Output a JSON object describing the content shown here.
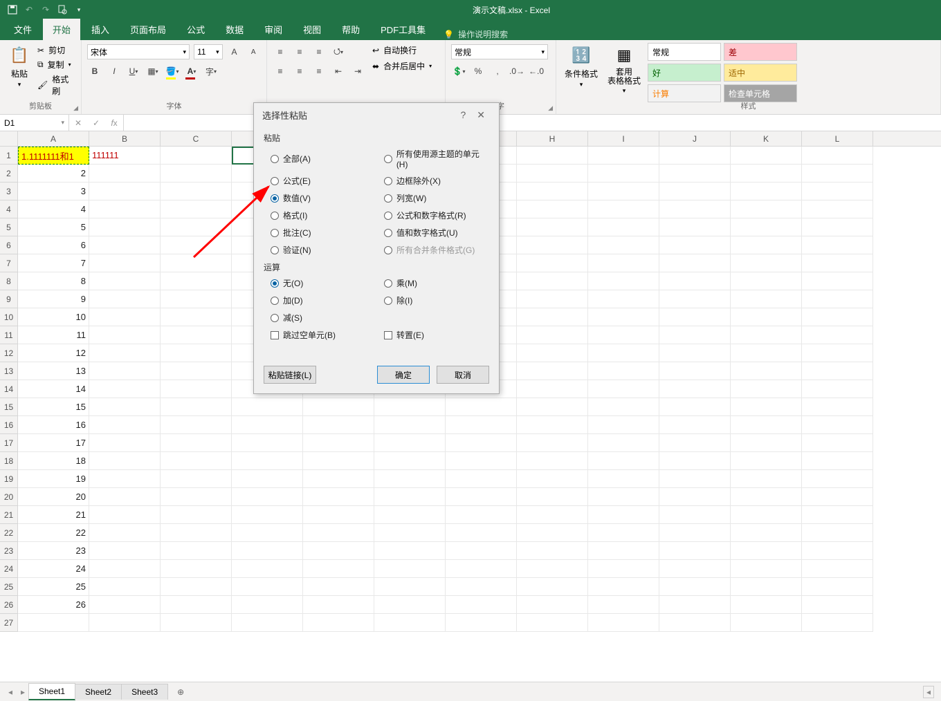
{
  "app": {
    "title": "演示文稿.xlsx  -  Excel"
  },
  "tabs": [
    "文件",
    "开始",
    "插入",
    "页面布局",
    "公式",
    "数据",
    "审阅",
    "视图",
    "帮助",
    "PDF工具集"
  ],
  "tellme": "操作说明搜索",
  "ribbon": {
    "clipboard": {
      "paste": "粘贴",
      "cut": "剪切",
      "copy": "复制",
      "painter": "格式刷",
      "label": "剪贴板"
    },
    "font": {
      "name": "宋体",
      "size": "11",
      "label": "字体"
    },
    "alignment": {
      "wrap": "自动换行",
      "merge": "合并后居中",
      "label": "字"
    },
    "number": {
      "format": "常规",
      "label": ""
    },
    "styles": {
      "cond": "条件格式",
      "tablefmt": "套用\n表格格式",
      "label": "样式",
      "cells": {
        "normal": "常规",
        "bad": "差",
        "good": "好",
        "neutral": "适中",
        "calc": "计算",
        "check": "检查单元格"
      }
    }
  },
  "namebox": "D1",
  "columns": [
    "A",
    "B",
    "C",
    "",
    "",
    "",
    "",
    "H",
    "I",
    "J",
    "K",
    "L"
  ],
  "rowData": {
    "1": {
      "A": "1.1111111和1",
      "B": "111111"
    },
    "2": {
      "A": "2"
    },
    "3": {
      "A": "3"
    },
    "4": {
      "A": "4"
    },
    "5": {
      "A": "5"
    },
    "6": {
      "A": "6"
    },
    "7": {
      "A": "7"
    },
    "8": {
      "A": "8"
    },
    "9": {
      "A": "9"
    },
    "10": {
      "A": "10"
    },
    "11": {
      "A": "11"
    },
    "12": {
      "A": "12"
    },
    "13": {
      "A": "13"
    },
    "14": {
      "A": "14"
    },
    "15": {
      "A": "15"
    },
    "16": {
      "A": "16"
    },
    "17": {
      "A": "17"
    },
    "18": {
      "A": "18"
    },
    "19": {
      "A": "19"
    },
    "20": {
      "A": "20"
    },
    "21": {
      "A": "21"
    },
    "22": {
      "A": "22"
    },
    "23": {
      "A": "23"
    },
    "24": {
      "A": "24"
    },
    "25": {
      "A": "25"
    },
    "26": {
      "A": "26"
    }
  },
  "rowCount": 27,
  "sheets": [
    "Sheet1",
    "Sheet2",
    "Sheet3"
  ],
  "dialog": {
    "title": "选择性粘贴",
    "section_paste": "粘贴",
    "paste_opts_left": [
      "全部(A)",
      "公式(E)",
      "数值(V)",
      "格式(I)",
      "批注(C)",
      "验证(N)"
    ],
    "paste_opts_right": [
      "所有使用源主题的单元(H)",
      "边框除外(X)",
      "列宽(W)",
      "公式和数字格式(R)",
      "值和数字格式(U)",
      "所有合并条件格式(G)"
    ],
    "paste_selected": 2,
    "section_op": "运算",
    "op_opts_left": [
      "无(O)",
      "加(D)",
      "减(S)"
    ],
    "op_opts_right": [
      "乘(M)",
      "除(I)"
    ],
    "op_selected": 0,
    "skip": "跳过空单元(B)",
    "transpose": "转置(E)",
    "pastelink": "粘贴链接(L)",
    "ok": "确定",
    "cancel": "取消"
  }
}
